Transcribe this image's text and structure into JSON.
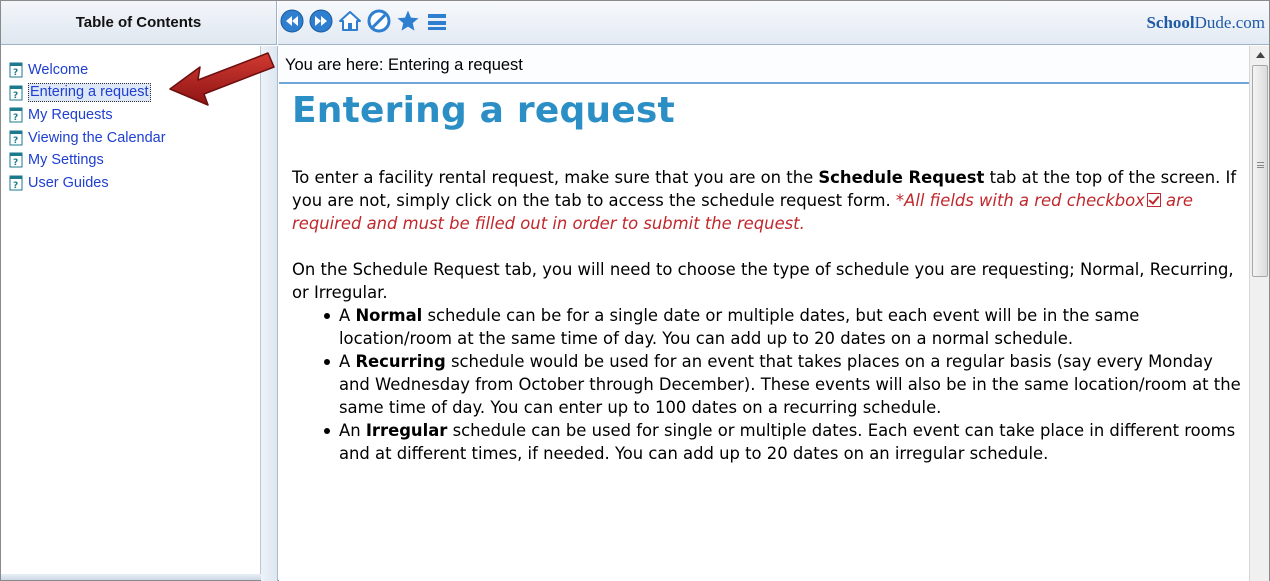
{
  "toc": {
    "title": "Table of Contents",
    "items": [
      {
        "label": "Welcome"
      },
      {
        "label": "Entering a request",
        "selected": true
      },
      {
        "label": "My Requests"
      },
      {
        "label": "Viewing the Calendar"
      },
      {
        "label": "My Settings"
      },
      {
        "label": "User Guides"
      }
    ]
  },
  "toolbar": {
    "buttons": [
      "back-icon",
      "forward-icon",
      "home-icon",
      "stop-icon",
      "favorite-star-icon",
      "print-icon"
    ],
    "brand_part1": "School",
    "brand_part2": "Dude.com"
  },
  "content": {
    "breadcrumb": "You are here: Entering a request",
    "title": "Entering a request",
    "intro_before_bold": "To enter a facility rental request, make sure that you are on the ",
    "intro_bold": "Schedule Request",
    "intro_after_bold": " tab at the top of the screen. If you are not, simply click on the tab to access the schedule request form. ",
    "note_before_icon": "*All fields with a red checkbox",
    "note_after_icon": " are required and must be filled out in order to submit the request.",
    "schedule_intro": "On the Schedule Request tab, you will need to choose the type of schedule you are requesting; Normal, Recurring, or Irregular.",
    "schedule_types": [
      {
        "prefix": "A ",
        "name": "Normal",
        "text": " schedule can be for a single date or multiple dates, but each event will be in the same location/room at the same time of day. You can add up to 20 dates on a normal schedule."
      },
      {
        "prefix": "A ",
        "name": "Recurring",
        "text": " schedule would be used for an event that takes places on a regular basis (say every Monday and Wednesday from October through December). These events will also be in the same location/room at the same time of day. You can enter up to 100 dates on a recurring schedule."
      },
      {
        "prefix": "An ",
        "name": "Irregular",
        "text": " schedule can be used for single or multiple dates. Each event can take place in different rooms and at different times, if needed. You can add up to 20 dates on an irregular schedule."
      }
    ]
  },
  "colors": {
    "title_blue": "#2b8fc6",
    "link_blue": "#1e3fd0",
    "required_red": "#c0282c",
    "annotation_arrow": "#b22222"
  }
}
